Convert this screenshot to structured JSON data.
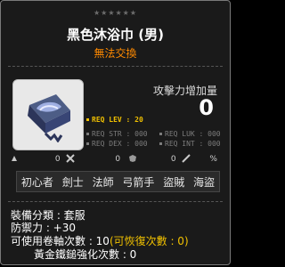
{
  "item": {
    "stars": "★★★★★★",
    "name": "黑色沐浴巾 (男)",
    "untradeable": "無法交換",
    "attack_increase_label": "攻擊力增加量",
    "attack_increase_value": "0",
    "requirements": {
      "lev": "REQ LEV : 20",
      "str": "REQ STR : 000",
      "dex": "REQ DEX : 000",
      "luk": "REQ LUK : 000",
      "int": "REQ INT : 000"
    },
    "status_values": [
      "0",
      "0",
      "0",
      "%"
    ],
    "jobs": [
      "初心者",
      "劍士",
      "法師",
      "弓箭手",
      "盜賊",
      "海盜"
    ],
    "category": "裝備分類 : 套服",
    "defense": "防禦力 : +30",
    "scroll_slots_prefix": "可使用卷軸次數 : 10",
    "scroll_slots_recoverable": "(可恢復次數 : 0)",
    "hammer": "黃金鐵鎚強化次數 : 0"
  }
}
